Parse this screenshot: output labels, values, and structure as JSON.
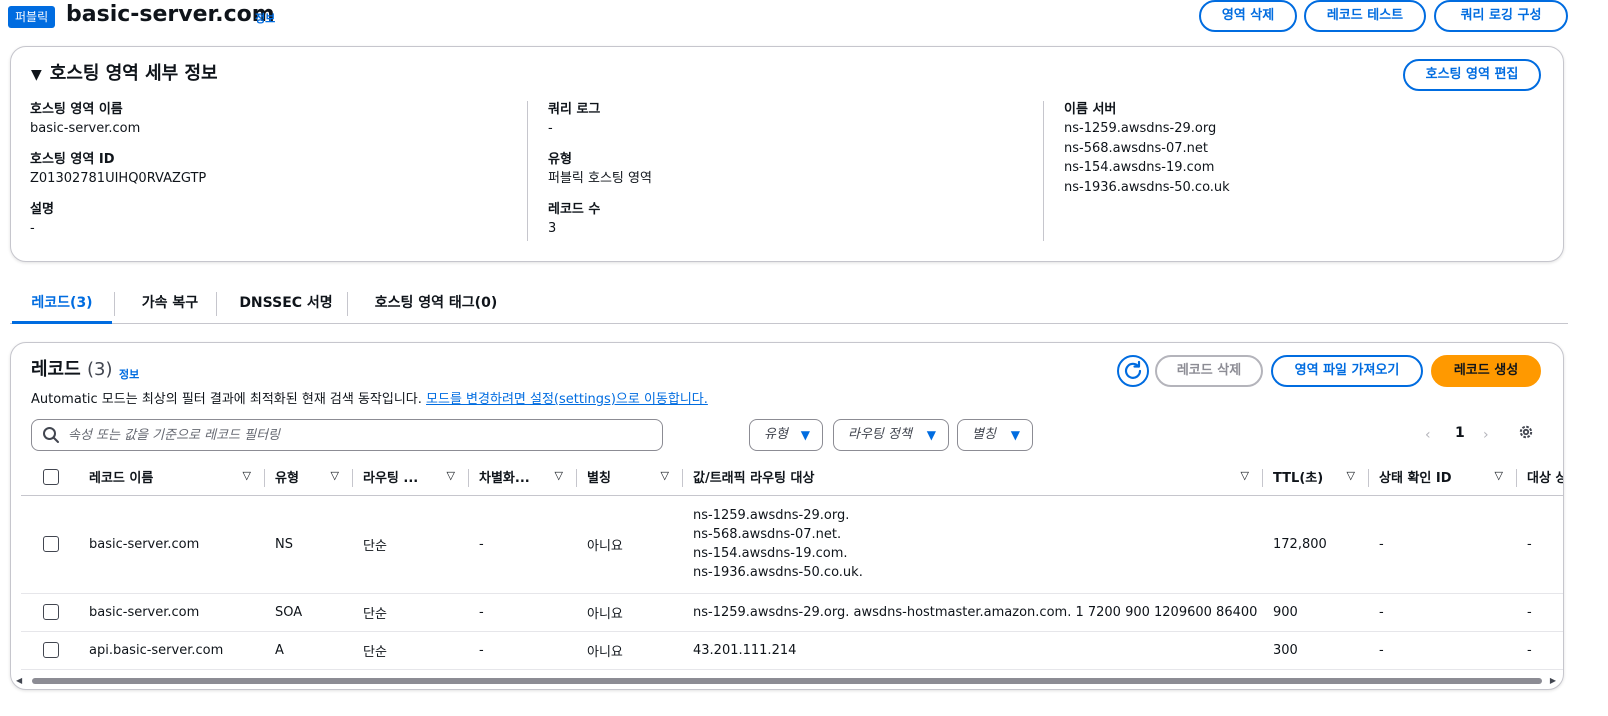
{
  "header": {
    "badge": "퍼블릭",
    "title": "basic-server.com",
    "info": "정보",
    "buttons": {
      "delete_zone": "영역 삭제",
      "test_record": "레코드 테스트",
      "query_logging": "쿼리 로깅 구성"
    }
  },
  "details": {
    "title": "호스팅 영역 세부 정보",
    "edit_button": "호스팅 영역 편집",
    "zone_name_label": "호스팅 영역 이름",
    "zone_name": "basic-server.com",
    "zone_id_label": "호스팅 영역 ID",
    "zone_id": "Z01302781UIHQ0RVAZGTP",
    "description_label": "설명",
    "description": "-",
    "query_log_label": "쿼리 로그",
    "query_log": "-",
    "type_label": "유형",
    "type": "퍼블릭 호스팅 영역",
    "record_count_label": "레코드 수",
    "record_count": "3",
    "name_servers_label": "이름 서버",
    "name_servers": [
      "ns-1259.awsdns-29.org",
      "ns-568.awsdns-07.net",
      "ns-154.awsdns-19.com",
      "ns-1936.awsdns-50.co.uk"
    ]
  },
  "tabs": [
    {
      "label": "레코드(3)",
      "active": true
    },
    {
      "label": "가속 복구",
      "active": false
    },
    {
      "label": "DNSSEC 서명",
      "active": false
    },
    {
      "label": "호스팅 영역 태그(0)",
      "active": false
    }
  ],
  "records": {
    "title": "레코드",
    "count": "(3)",
    "info": "정보",
    "description_text": "Automatic 모드는 최상의 필터 결과에 최적화된 현재 검색 동작입니다.",
    "description_link": "모드를 변경하려면 설정(settings)으로 이동합니다.",
    "buttons": {
      "delete": "레코드 삭제",
      "import": "영역 파일 가져오기",
      "create": "레코드 생성"
    },
    "search_placeholder": "속성 또는 값을 기준으로 레코드 필터링",
    "filters": {
      "type": "유형",
      "routing": "라우팅 정책",
      "alias": "별칭"
    },
    "page": "1",
    "columns": [
      "레코드 이름",
      "유형",
      "라우팅 ...",
      "차별화...",
      "별칭",
      "값/트래픽 라우팅 대상",
      "TTL(초)",
      "상태 확인 ID",
      "대상 상"
    ],
    "rows": [
      {
        "name": "basic-server.com",
        "type": "NS",
        "routing": "단순",
        "diff": "-",
        "alias": "아니요",
        "values": [
          "ns-1259.awsdns-29.org.",
          "ns-568.awsdns-07.net.",
          "ns-154.awsdns-19.com.",
          "ns-1936.awsdns-50.co.uk."
        ],
        "ttl": "172,800",
        "health": "-",
        "target": "-"
      },
      {
        "name": "basic-server.com",
        "type": "SOA",
        "routing": "단순",
        "diff": "-",
        "alias": "아니요",
        "values": [
          "ns-1259.awsdns-29.org. awsdns-hostmaster.amazon.com. 1 7200 900 1209600 86400"
        ],
        "ttl": "900",
        "health": "-",
        "target": "-"
      },
      {
        "name": "api.basic-server.com",
        "type": "A",
        "routing": "단순",
        "diff": "-",
        "alias": "아니요",
        "values": [
          "43.201.111.214"
        ],
        "ttl": "300",
        "health": "-",
        "target": "-"
      }
    ]
  },
  "colors": {
    "accent": "#006ce0",
    "primary_button": "#ff9900",
    "border": "#c6c6cd"
  }
}
